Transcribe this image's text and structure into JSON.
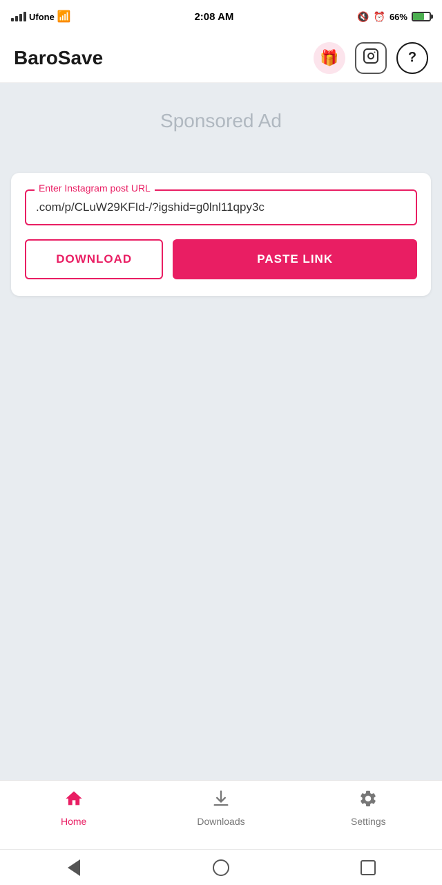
{
  "statusBar": {
    "carrier": "Ufone",
    "time": "2:08 AM",
    "batteryPercent": "66%"
  },
  "header": {
    "logo": "BaroSave",
    "giftIcon": "🎁",
    "instagramIcon": "📷",
    "helpIcon": "?"
  },
  "adBanner": {
    "text": "Sponsored Ad"
  },
  "urlInput": {
    "label": "Enter Instagram post URL",
    "value": ".com/p/CLuW29KFId-/?igshid=g0lnl11qpy3c"
  },
  "buttons": {
    "download": "DOWNLOAD",
    "pasteLink": "PASTE LINK"
  },
  "bottomNav": {
    "items": [
      {
        "id": "home",
        "label": "Home",
        "active": true
      },
      {
        "id": "downloads",
        "label": "Downloads",
        "active": false
      },
      {
        "id": "settings",
        "label": "Settings",
        "active": false
      }
    ]
  },
  "colors": {
    "primary": "#e91e63",
    "activeNav": "#e91e63",
    "inactiveNav": "#777777"
  }
}
